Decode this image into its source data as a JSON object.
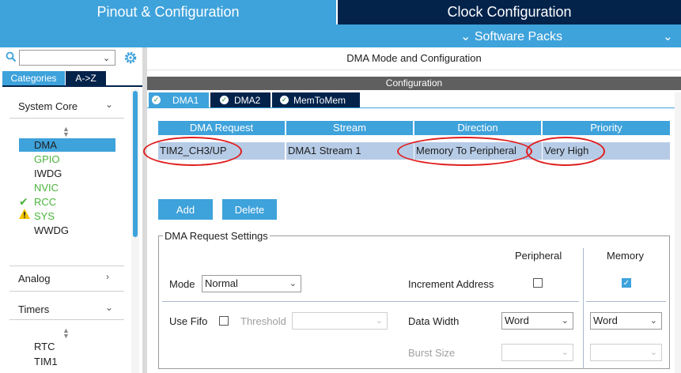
{
  "top_tabs": {
    "pinout": "Pinout & Configuration",
    "clock": "Clock Configuration"
  },
  "software_packs": {
    "label": "Software Packs",
    "chevron": "⌄"
  },
  "sidebar": {
    "search_value": "",
    "tabs": {
      "categories": "Categories",
      "az": "A->Z"
    },
    "system_core": {
      "label": "System Core",
      "items": [
        "DMA",
        "GPIO",
        "IWDG",
        "NVIC",
        "RCC",
        "SYS",
        "WWDG"
      ]
    },
    "analog": {
      "label": "Analog"
    },
    "timers": {
      "label": "Timers",
      "items": [
        "RTC",
        "TIM1"
      ]
    }
  },
  "main": {
    "title": "DMA Mode and Configuration",
    "config_label": "Configuration",
    "dma_tabs": [
      "DMA1",
      "DMA2",
      "MemToMem"
    ],
    "table": {
      "headers": [
        "DMA Request",
        "Stream",
        "Direction",
        "Priority"
      ],
      "rows": [
        [
          "TIM2_CH3/UP",
          "DMA1 Stream 1",
          "Memory To Peripheral",
          "Very High"
        ]
      ]
    },
    "buttons": {
      "add": "Add",
      "delete": "Delete"
    },
    "settings": {
      "legend": "DMA Request Settings",
      "peripheral_col": "Peripheral",
      "memory_col": "Memory",
      "mode_label": "Mode",
      "mode_value": "Normal",
      "increment_label": "Increment Address",
      "peripheral_increment": false,
      "memory_increment": true,
      "use_fifo_label": "Use Fifo",
      "use_fifo": false,
      "threshold_label": "Threshold",
      "threshold_value": "",
      "data_width_label": "Data Width",
      "peripheral_data_width": "Word",
      "memory_data_width": "Word",
      "burst_size_label": "Burst Size",
      "peripheral_burst": "",
      "memory_burst": ""
    }
  },
  "colors": {
    "accent": "#3ea2db",
    "dark_navy": "#03234b",
    "selected_row": "#b6cbe6",
    "annotation_red": "#e01e1e",
    "ok_green": "#4bb33c",
    "warn_yellow": "#f3c300"
  },
  "icons": {
    "search": "search-icon",
    "settings": "gear-icon",
    "check": "check-icon",
    "warning": "warning-icon"
  }
}
